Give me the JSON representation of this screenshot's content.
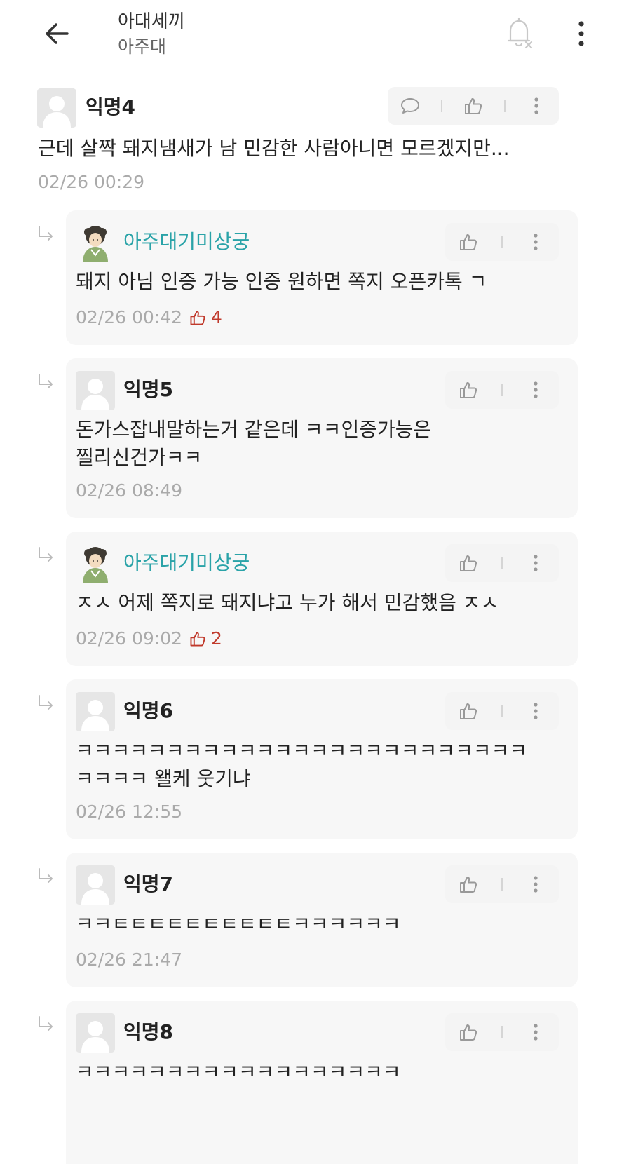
{
  "header": {
    "title": "아대세끼",
    "subtitle": "아주대",
    "back_icon": "arrow-left-icon",
    "bell_icon": "bell-off-icon",
    "more_icon": "more-vertical-icon"
  },
  "main_comment": {
    "author": "익명4",
    "text": "근데 살짝 돼지냄새가 남 민감한 사람아니면 모르겠지만...",
    "time": "02/26 00:29"
  },
  "replies": [
    {
      "author": "아주대기미상궁",
      "text": "돼지 아님 인증 가능 인증 원하면 쪽지 오픈카톡 ㄱ",
      "time": "02/26 00:42",
      "likes": "4"
    },
    {
      "author": "익명5",
      "text": "돈가스잡내말하는거 같은데 ㅋㅋ인증가능은\n찔리신건가ㅋㅋ",
      "time": "02/26 08:49"
    },
    {
      "author": "아주대기미상궁",
      "text": "ㅈㅅ 어제 쪽지로 돼지냐고 누가 해서 민감했음 ㅈㅅ",
      "time": "02/26 09:02",
      "likes": "2"
    },
    {
      "author": "익명6",
      "text": "ㅋㅋㅋㅋㅋㅋㅋㅋㅋㅋㅋㅋㅋㅋㅋㅋㅋㅋㅋㅋㅋㅋㅋㅋㅋ\nㅋㅋㅋㅋ 왤케 웃기냐",
      "time": "02/26 12:55"
    },
    {
      "author": "익명7",
      "text": "ㅋㅋㅌㅌㅌㅌㅌㅌㅌㅌㅌㅌㅋㅋㅋㅋㅋㅋ",
      "time": "02/26 21:47"
    },
    {
      "author": "익명8",
      "text": "ㅋㅋㅋㅋㅋㅋㅋㅋㅋㅋㅋㅋㅋㅋㅋㅋㅋㅋ"
    }
  ],
  "icons": {
    "comment": "speech-bubble-icon",
    "like": "thumbs-up-icon",
    "more": "more-vertical-icon",
    "reply": "reply-arrow-icon",
    "avatar_default": "default-avatar-icon",
    "avatar_character": "character-avatar-icon"
  },
  "colors": {
    "accent_name": "#2aa3a8",
    "like_count": "#c0392b",
    "timestamp": "#aaaaaa",
    "card_bg": "#f7f7f7"
  }
}
